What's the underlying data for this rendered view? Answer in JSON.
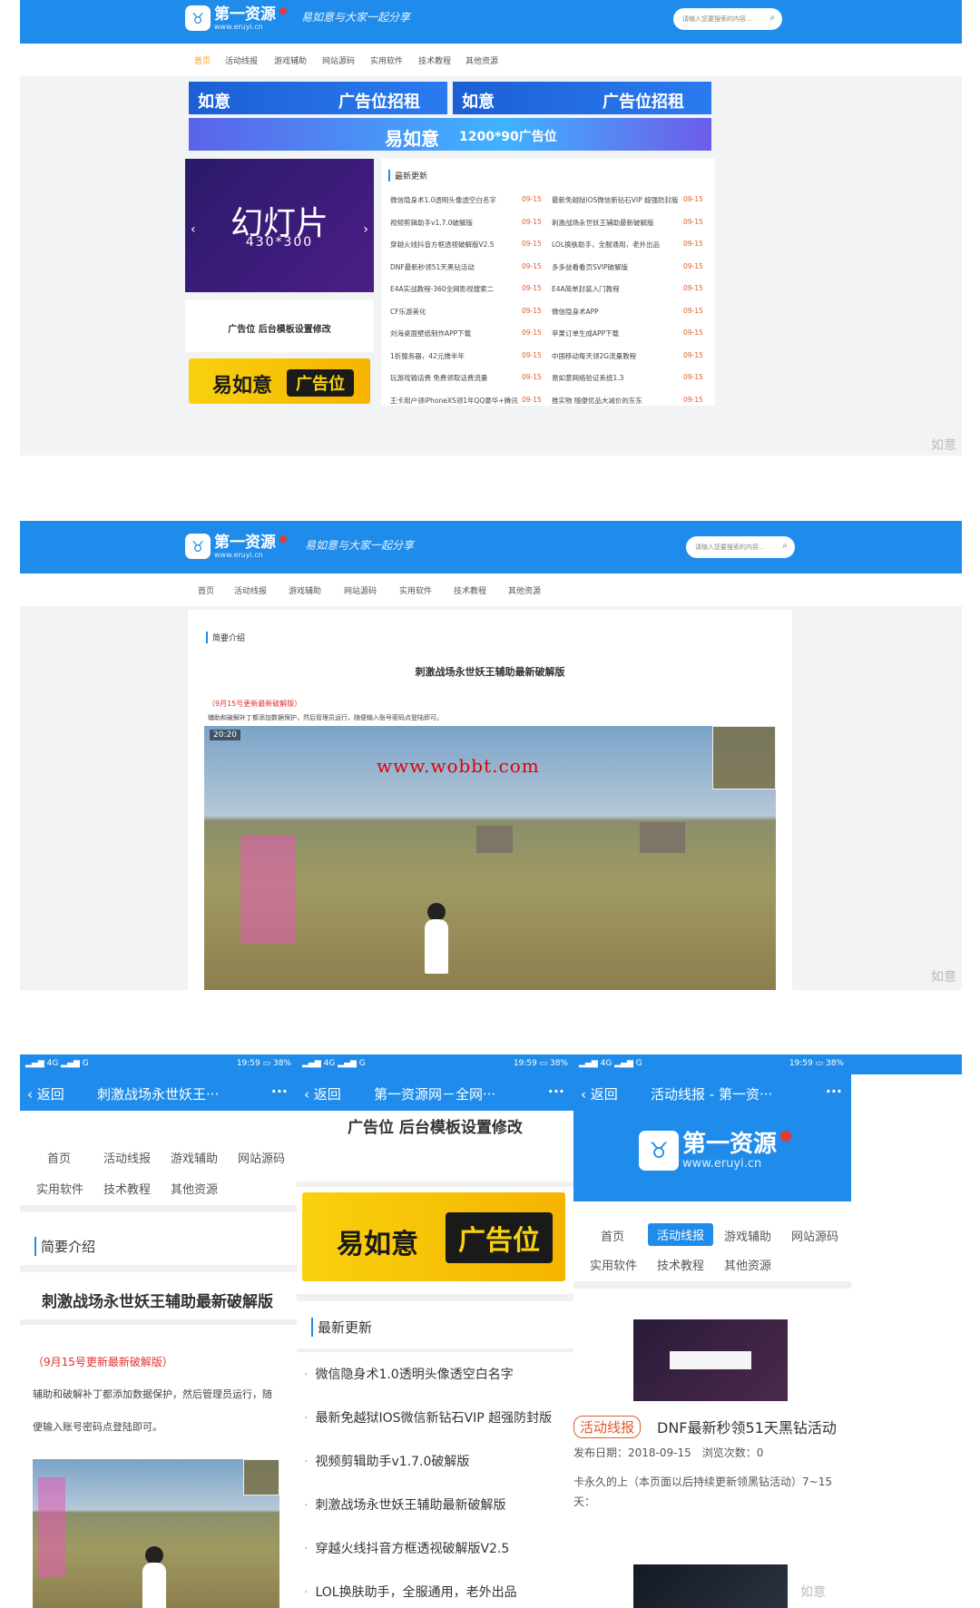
{
  "site": {
    "name": "第一资源",
    "url": "www.eruyi.cn",
    "slogan": "易如意与大家一起分享",
    "search_placeholder": "请输入您要搜索的内容...",
    "brand_color": "#1f8ceb"
  },
  "nav": [
    "首页",
    "活动线报",
    "游戏辅助",
    "网站源码",
    "实用软件",
    "技术教程",
    "其他资源"
  ],
  "shot1": {
    "banner_ad_left_brand": "如意",
    "banner_ad_left_text": "广告位招租",
    "banner_ad_right_brand": "如意",
    "banner_ad_right_text": "广告位招租",
    "wide_ad_brand": "易如意",
    "wide_ad_text": "1200*90广告位",
    "slide_title": "幻灯片",
    "slide_size": "430*300",
    "ad_setting": "广告位 后台模板设置修改",
    "yellow_brand": "易如意",
    "yellow_text": "广告位",
    "latest_title": "最新更新",
    "latest_left": [
      {
        "t": "微信隐身术1.0透明头像透空白名字",
        "d": "09-15"
      },
      {
        "t": "视频剪辑助手v1.7.0破解版",
        "d": "09-15"
      },
      {
        "t": "穿越火线抖音方框透视破解版V2.5",
        "d": "09-15"
      },
      {
        "t": "DNF最新秒领51天黑钻活动",
        "d": "09-15"
      },
      {
        "t": "E4A实战教程-360全网影视搜索二",
        "d": "09-15"
      },
      {
        "t": "CF乐游美化",
        "d": "09-15"
      },
      {
        "t": "刘海桌面壁纸制作APP下载",
        "d": "09-15"
      },
      {
        "t": "1折服务器，42元撸半年",
        "d": "09-15"
      },
      {
        "t": "玩游戏输话费 免费领取话费流量",
        "d": "09-15"
      },
      {
        "t": "王卡用户领iPhoneXS领1年QQ豪华+腾讯",
        "d": "09-15"
      }
    ],
    "latest_right": [
      {
        "t": "最新免越狱iOS微信新钻石VIP 超强防封版",
        "d": "09-15"
      },
      {
        "t": "刺激战场永世妖王辅助最新破解版",
        "d": "09-15"
      },
      {
        "t": "LOL换肤助手，全服通用，老外出品",
        "d": "09-15"
      },
      {
        "t": "多多益看看页SVIP破解版",
        "d": "09-15"
      },
      {
        "t": "E4A简单封装入门教程",
        "d": "09-15"
      },
      {
        "t": "微信隐身术APP",
        "d": "09-15"
      },
      {
        "t": "苹果订单生成APP下载",
        "d": "09-15"
      },
      {
        "t": "中国移动每天领2G流量教程",
        "d": "09-15"
      },
      {
        "t": "易如意网络验证系统1.3",
        "d": "09-15"
      },
      {
        "t": "推实物 随便优品大减价的东东",
        "d": "09-15"
      }
    ],
    "watermark": "如意"
  },
  "shot2": {
    "section": "简要介绍",
    "article_title": "刺激战场永世妖王辅助最新破解版",
    "update_note": "（9月15号更新最新破解版）",
    "body": "辅助和破解补丁都添加数据保护，然后管理员运行，随便输入账号密码点登陆即可。",
    "game_url_overlay": "www.wobbt.com",
    "hud_time": "20:20",
    "watermark": "如意"
  },
  "phone1": {
    "time": "19:59",
    "battery": "38%",
    "back": "返回",
    "title": "刺激战场永世妖王···",
    "more": "···",
    "section": "简要介绍",
    "article_title": "刺激战场永世妖王辅助最新破解版",
    "update_note": "（9月15号更新最新破解版）",
    "body1": "辅助和破解补丁都添加数据保护，然后管理员运行，随",
    "body2": "便输入账号密码点登陆即可。"
  },
  "phone2": {
    "time": "19:59",
    "battery": "38%",
    "back": "返回",
    "title": "第一资源网－全网···",
    "more": "···",
    "ad_setting": "广告位 后台模板设置修改",
    "yellow_brand": "易如意",
    "yellow_text": "广告位",
    "latest_title": "最新更新",
    "items": [
      "微信隐身术1.0透明头像透空白名字",
      "最新免越狱IOS微信新钻石VIP 超强防封版",
      "视频剪辑助手v1.7.0破解版",
      "刺激战场永世妖王辅助最新破解版",
      "穿越火线抖音方框透视破解版V2.5",
      "LOL换肤助手，全服通用，老外出品"
    ]
  },
  "phone3": {
    "time": "19:59",
    "battery": "38%",
    "back": "返回",
    "title": "活动线报 - 第一资···",
    "more": "···",
    "tag": "活动线报",
    "post_title": "DNF最新秒领51天黑钻活动",
    "meta": "发布日期：2018-09-15　浏览次数：0",
    "excerpt": "卡永久的上（本页面以后持续更新领黑钻活动）7~15天：",
    "watermark": "如意"
  }
}
